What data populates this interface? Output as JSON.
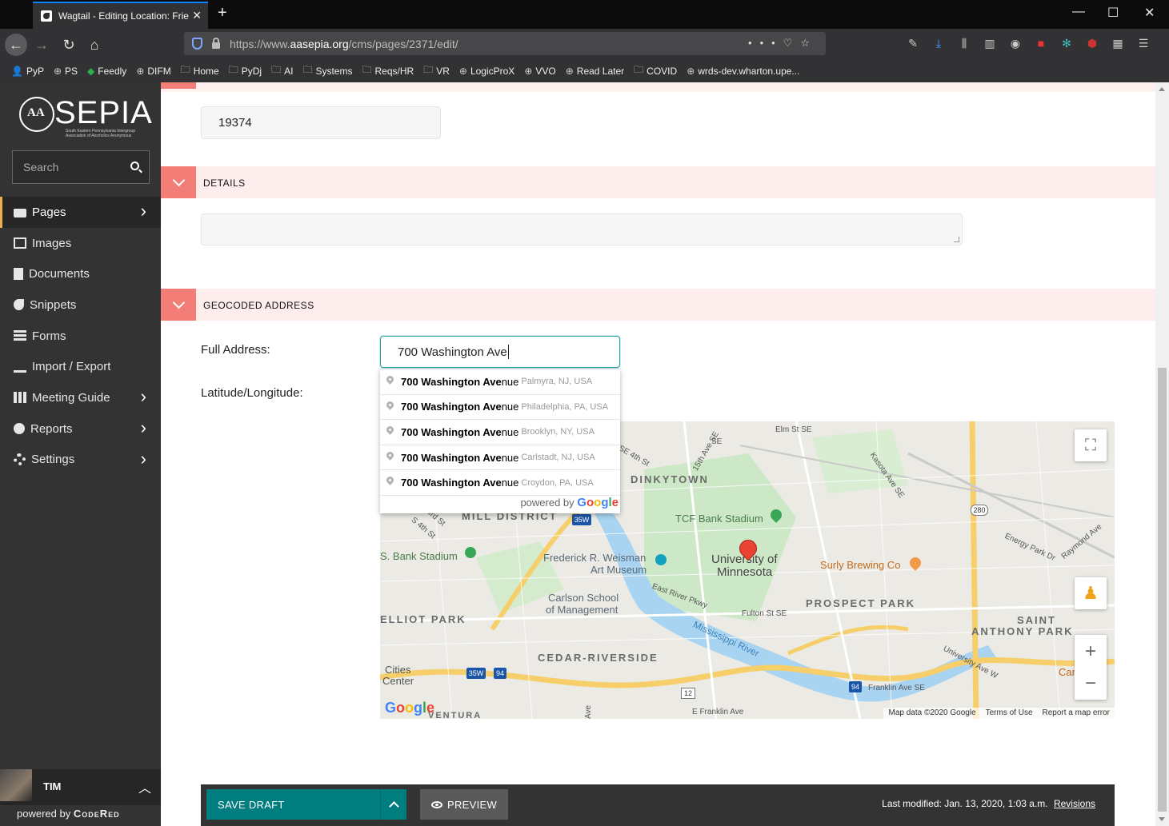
{
  "browser": {
    "tab_title": "Wagtail - Editing Location: Frie",
    "url_prefix": "https://www.",
    "url_host": "aasepia.org",
    "url_path": "/cms/pages/2371/edit/",
    "bookmarks": [
      {
        "label": "PyP",
        "icon": "person-icon"
      },
      {
        "label": "PS",
        "icon": "globe-icon"
      },
      {
        "label": "Feedly",
        "icon": "feedly-icon"
      },
      {
        "label": "DIFM",
        "icon": "globe-icon"
      },
      {
        "label": "Home",
        "icon": "folder-icon"
      },
      {
        "label": "PyDj",
        "icon": "folder-icon"
      },
      {
        "label": "AI",
        "icon": "folder-icon"
      },
      {
        "label": "Systems",
        "icon": "folder-icon"
      },
      {
        "label": "Reqs/HR",
        "icon": "folder-icon"
      },
      {
        "label": "VR",
        "icon": "folder-icon"
      },
      {
        "label": "LogicProX",
        "icon": "globe-icon"
      },
      {
        "label": "VVO",
        "icon": "globe-icon"
      },
      {
        "label": "Read Later",
        "icon": "globe-icon"
      },
      {
        "label": "COVID",
        "icon": "folder-icon"
      },
      {
        "label": "wrds-dev.wharton.upe...",
        "icon": "globe-icon"
      }
    ]
  },
  "sidebar": {
    "logo_text": "SEPIA",
    "logo_subtitle": "South Eastern Pennsylvania Intergroup Association of Alcoholics Anonymous",
    "search_placeholder": "Search",
    "items": [
      {
        "label": "Pages",
        "icon": "folder-open-icon",
        "has_submenu": true,
        "active": true
      },
      {
        "label": "Images",
        "icon": "image-icon",
        "has_submenu": false
      },
      {
        "label": "Documents",
        "icon": "document-icon",
        "has_submenu": false
      },
      {
        "label": "Snippets",
        "icon": "snippet-icon",
        "has_submenu": false
      },
      {
        "label": "Forms",
        "icon": "form-icon",
        "has_submenu": false
      },
      {
        "label": "Import / Export",
        "icon": "download-icon",
        "has_submenu": false
      },
      {
        "label": "Meeting Guide",
        "icon": "grid-icon",
        "has_submenu": true
      },
      {
        "label": "Reports",
        "icon": "globe-icon",
        "has_submenu": true
      },
      {
        "label": "Settings",
        "icon": "cogs-icon",
        "has_submenu": true
      }
    ],
    "user_name": "TIM",
    "powered_by_prefix": "powered by",
    "powered_by_brand": "CodeRed"
  },
  "form": {
    "zip_value": "19374",
    "details_section_title": "DETAILS",
    "details_value": "",
    "geocoded_section_title": "GEOCODED ADDRESS",
    "full_address_label": "Full Address:",
    "full_address_value": "700 Washington Ave",
    "latlng_label": "Latitude/Longitude:"
  },
  "autocomplete": {
    "items": [
      {
        "main_bold": "700 Washington Ave",
        "main_rest": "nue",
        "secondary": "Palmyra, NJ, USA"
      },
      {
        "main_bold": "700 Washington Ave",
        "main_rest": "nue",
        "secondary": "Philadelphia, PA, USA"
      },
      {
        "main_bold": "700 Washington Ave",
        "main_rest": "nue",
        "secondary": "Brooklyn, NY, USA"
      },
      {
        "main_bold": "700 Washington Ave",
        "main_rest": "nue",
        "secondary": "Carlstadt, NJ, USA"
      },
      {
        "main_bold": "700 Washington Ave",
        "main_rest": "nue",
        "secondary": "Croydon, PA, USA"
      }
    ],
    "powered_by": "powered by",
    "google": "Google"
  },
  "map": {
    "labels": {
      "dinkytown": "DINKYTOWN",
      "mill_district": "MILL DISTRICT",
      "tcf": "TCF Bank Stadium",
      "us_bank": "S. Bank Stadium",
      "weisman_1": "Frederick R. Weisman",
      "weisman_2": "Art Museum",
      "umn_1": "University of",
      "umn_2": "Minnesota",
      "surly": "Surly Brewing Co",
      "carlson_1": "Carlson School",
      "carlson_2": "of Management",
      "prospect": "PROSPECT PARK",
      "saint_1": "SAINT",
      "saint_2": "ANTHONY PARK",
      "elliot": "ELLIOT PARK",
      "cedar": "CEDAR-RIVERSIDE",
      "cities_1": "Cities",
      "cities_2": "Center",
      "mississippi": "Mississippi River",
      "elm": "Elm St SE",
      "fulton": "Fulton St SE",
      "east_river": "East River Pkwy",
      "franklin_se": "Franklin Ave SE",
      "e_franklin": "E Franklin Ave",
      "university_ave": "University Ave W",
      "energy": "Energy Park Dr",
      "raymond": "Raymond Ave",
      "kasota": "Kasota Ave SE",
      "st15": "15th Ave SE",
      "st4": "SE 4th St",
      "st3": "S 3rd St",
      "st4s": "S 4th St",
      "can": "Can C",
      "ventura": "VENTURA",
      "ave": "Ave",
      "se": "SE",
      "hwy280": "280",
      "hwy35w_a": "35W",
      "hwy35w_b": "35W",
      "hwy94_a": "94",
      "hwy94_b": "94",
      "hwy12": "12"
    },
    "footer_data": "Map data ©2020 Google",
    "footer_terms": "Terms of Use",
    "footer_report": "Report a map error",
    "google_logo": "Google",
    "zoom_in": "+",
    "zoom_out": "−"
  },
  "footer": {
    "save_label": "SAVE DRAFT",
    "preview_label": "PREVIEW",
    "modified_text": "Last modified: Jan. 13, 2020, 1:03 a.m.",
    "revisions_label": "Revisions"
  },
  "colors": {
    "accent_teal": "#007d7e",
    "section_coral": "#f37e77",
    "section_band": "#fdeeed",
    "sidebar_bg": "#333333"
  }
}
